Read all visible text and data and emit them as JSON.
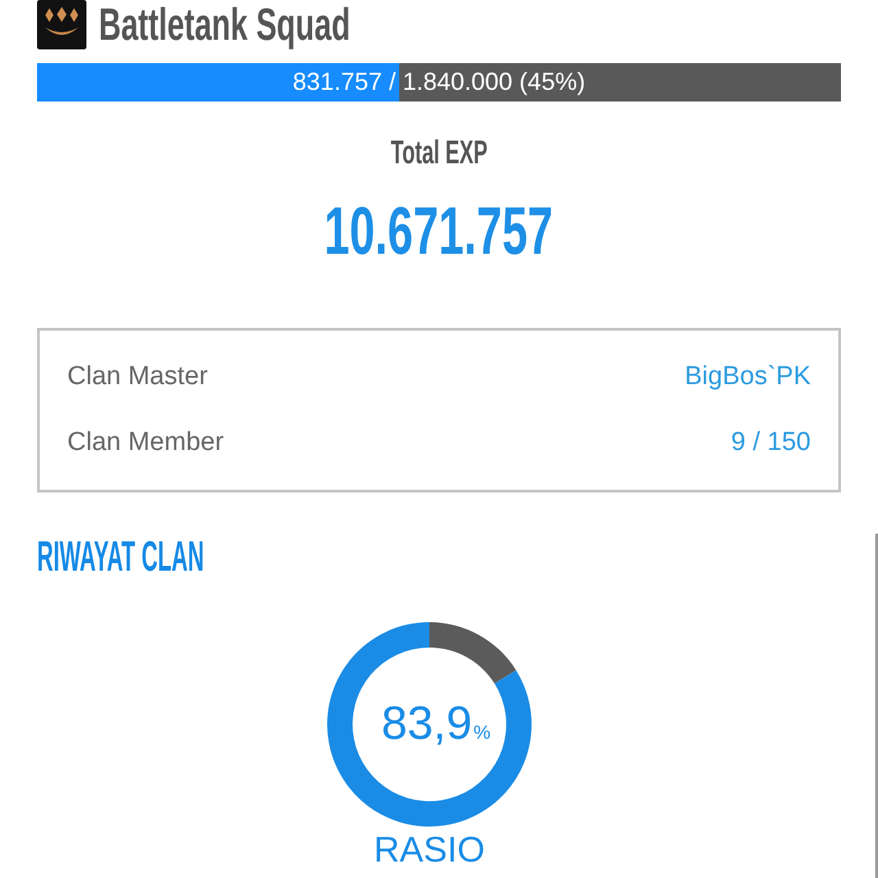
{
  "header": {
    "title": "Battletank Squad"
  },
  "exp_bar": {
    "level": 0.45,
    "reading": "831.757 / 1.840.000 (45%)"
  },
  "total_exp": {
    "label": "Total EXP",
    "value": "10.671.757"
  },
  "info": [
    {
      "label": "Clan Master",
      "value": "BigBos`PK"
    },
    {
      "label": "Clan Member",
      "value": "9 / 150"
    }
  ],
  "history": {
    "title": "RIWAYAT CLAN",
    "ratio": {
      "value": "83,9",
      "unit": "%",
      "label": "RASIO",
      "chart_data": {
        "type": "donut",
        "values": [
          83.9,
          16.1
        ]
      }
    }
  }
}
